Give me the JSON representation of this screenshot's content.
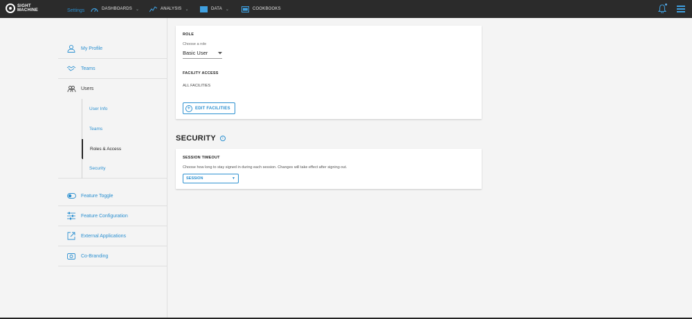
{
  "brand": {
    "line1": "SIGHT",
    "line2": "MACHINE"
  },
  "nav": {
    "dashboards": "DASHBOARDS",
    "analysis": "ANALYSIS",
    "data": "DATA",
    "cookbooks": "COOKBOOKS",
    "caret": "⌄"
  },
  "sidebar": {
    "title": "Settings",
    "my_profile": "My Profile",
    "teams": "Teams",
    "users": "Users",
    "users_sub": {
      "user_info": "User Info",
      "teams": "Teams",
      "roles_access": "Roles & Access",
      "security": "Security"
    },
    "feature_toggle": "Feature Toggle",
    "feature_configuration": "Feature Configuration",
    "external_applications": "External Applications",
    "co_branding": "Co-Branding"
  },
  "role_card": {
    "role_heading": "ROLE",
    "choose_label": "Choose a role",
    "role_value": "Basic User",
    "facility_heading": "FACILITY ACCESS",
    "facility_value": "ALL FACILITIES",
    "edit_button": "EDIT FACILITIES"
  },
  "security": {
    "title": "SECURITY",
    "timeout_heading": "SESSION TIMEOUT",
    "timeout_desc": "Choose how long to stay signed in during each session. Changes will take effect after signing out.",
    "select_value": "SESSION",
    "select_arrow": "▼"
  },
  "colors": {
    "accent": "#2a8fd0",
    "topbar": "#2b2b2b",
    "background": "#f4f4f4"
  }
}
